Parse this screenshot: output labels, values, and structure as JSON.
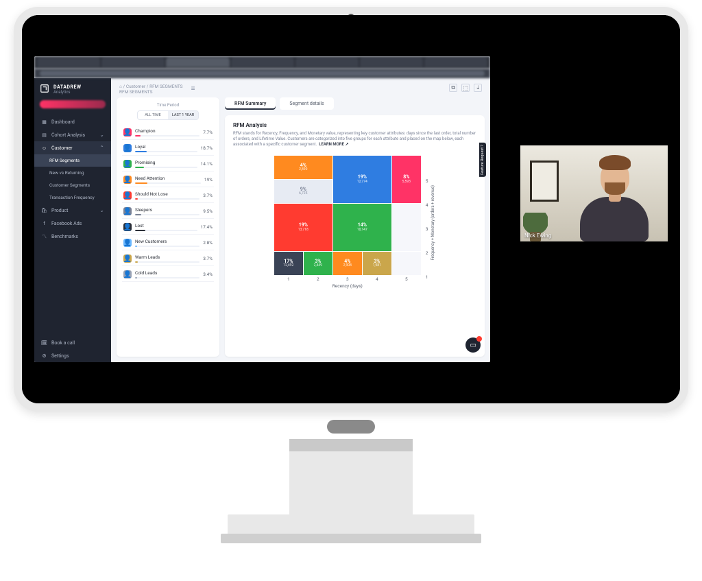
{
  "brand": {
    "name": "DATADREW",
    "tagline": "Analytics"
  },
  "nav": {
    "dashboard": "Dashboard",
    "cohort": "Cohort Analysis",
    "customer": "Customer",
    "rfm": "RFM Segments",
    "nvr": "New vs Returning",
    "cs": "Customer Segments",
    "tf": "Transaction Frequency",
    "product": "Product",
    "fb": "Facebook Ads",
    "bench": "Benchmarks",
    "book": "Book a call",
    "settings": "Settings"
  },
  "crumbs": {
    "home": "⌂",
    "a": "Customer",
    "b": "RFM SEGMENTS",
    "title": "RFM SEGMENTS"
  },
  "toolbar": {
    "i1": "⧉",
    "i2": "⬚",
    "i3": "⤓"
  },
  "timePeriod": {
    "label": "Time Period",
    "all": "ALL TIME",
    "last": "LAST 1 YEAR"
  },
  "segments": [
    {
      "name": "Champion",
      "pct": "7.7%",
      "color": "#ff3366",
      "bar": 8
    },
    {
      "name": "Loyal",
      "pct": "18.7%",
      "color": "#2f7de1",
      "bar": 19
    },
    {
      "name": "Promising",
      "pct": "14.1%",
      "color": "#2fb24c",
      "bar": 14
    },
    {
      "name": "Need Attention",
      "pct": "19%",
      "color": "#ff8a1f",
      "bar": 19
    },
    {
      "name": "Should Not Lose",
      "pct": "3.7%",
      "color": "#ff3b30",
      "bar": 4
    },
    {
      "name": "Sleepers",
      "pct": "9.5%",
      "color": "#7a8296",
      "bar": 10
    },
    {
      "name": "Lost",
      "pct": "17.4%",
      "color": "#2b2f38",
      "bar": 17
    },
    {
      "name": "New Customers",
      "pct": "2.8%",
      "color": "#69b7ff",
      "bar": 3
    },
    {
      "name": "Warm Leads",
      "pct": "3.7%",
      "color": "#caa64b",
      "bar": 4
    },
    {
      "name": "Cold Leads",
      "pct": "3.4%",
      "color": "#9aa3b5",
      "bar": 3
    }
  ],
  "tabs": {
    "summary": "RFM Summary",
    "details": "Segment details"
  },
  "analysis": {
    "heading": "RFM Analysis",
    "body": "RFM stands for Recency, Frequency, and Monetary value, representing key customer attributes: days since the last order, total number of orders, and Lifetime Value. Customers are categorized into five groups for each attribute and placed on the map below, each associated with a specific customer segment.",
    "learn": "LEARN MORE ↗"
  },
  "sideTag": "Feature Request ?",
  "axis": {
    "x": "Recency (days)",
    "y": "Frequency + Monetary (orders + revenue)",
    "xticks": [
      "1",
      "2",
      "3",
      "4",
      "5"
    ],
    "yticks": [
      "5",
      "4",
      "3",
      "2",
      "1"
    ]
  },
  "chart_data": {
    "type": "heatmap",
    "xlabel": "Recency (days)",
    "ylabel": "Frequency + Monetary (orders + revenue)",
    "x": [
      1,
      2,
      3,
      4,
      5
    ],
    "y": [
      1,
      2,
      3,
      4,
      5
    ],
    "cells": [
      {
        "x": 1,
        "y": 1,
        "pct": 17,
        "count": 12492,
        "color": "#3a4356"
      },
      {
        "x": 2,
        "y": 1,
        "pct": 3,
        "count": 2449,
        "color": "#2fb24c"
      },
      {
        "x": 3,
        "y": 1,
        "pct": 4,
        "count": 2908,
        "color": "#ff8a1f"
      },
      {
        "x": 4,
        "y": 1,
        "pct": 3,
        "count": 1981,
        "color": "#caa64b"
      },
      {
        "x": 1,
        "y": 2,
        "pct": 19,
        "count": 13718,
        "color": "#ff3b30",
        "span_x": 2,
        "span_y": 2
      },
      {
        "x": 3,
        "y": 2,
        "pct": 14,
        "count": 10147,
        "color": "#2fb24c",
        "span_x": 2,
        "span_y": 2
      },
      {
        "x": 1,
        "y": 4,
        "pct": 9,
        "count": 6725,
        "color": "#8a93a6",
        "span_x": 2
      },
      {
        "x": 1,
        "y": 5,
        "pct": 4,
        "count": 2890,
        "color": "#ff8a1f",
        "span_x": 2
      },
      {
        "x": 3,
        "y": 4,
        "pct": 19,
        "count": 12774,
        "color": "#2f7de1",
        "span_x": 2,
        "span_y": 2
      },
      {
        "x": 5,
        "y": 4,
        "pct": 8,
        "count": 5593,
        "color": "#ff3366",
        "span_y": 2
      }
    ]
  },
  "cells": {
    "c1": {
      "pct": "4%",
      "n": "2,890"
    },
    "c2": {
      "pct": "19%",
      "n": "12,774"
    },
    "c3": {
      "pct": "8%",
      "n": "5,593"
    },
    "c4": {
      "pct": "9%",
      "n": "6,725"
    },
    "c5": {
      "pct": "19%",
      "n": "13,718"
    },
    "c6": {
      "pct": "14%",
      "n": "10,147"
    },
    "c7": {
      "pct": "17%",
      "n": "12,492"
    },
    "c8": {
      "pct": "3%",
      "n": "2,449"
    },
    "c9": {
      "pct": "4%",
      "n": "2,908"
    },
    "c10": {
      "pct": "3%",
      "n": "1,981"
    }
  },
  "webcam": {
    "name": "Nick Ewing"
  }
}
